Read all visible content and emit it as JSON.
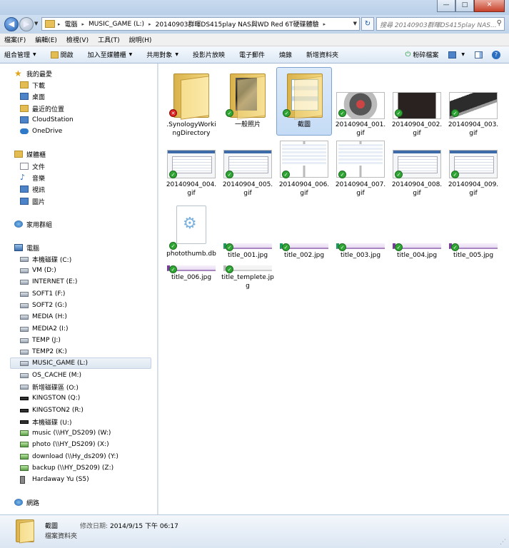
{
  "window": {
    "minimize_glyph": "—",
    "maximize_glyph": "□",
    "close_glyph": "✕"
  },
  "address": {
    "crumbs": [
      "電腦",
      "MUSIC_GAME (L:)",
      "20140903群暉DS415play NAS與WD Red 6T硬碟體驗"
    ],
    "search_placeholder": "搜尋 20140903群暉DS415play NAS..."
  },
  "menu": [
    "檔案(F)",
    "編輯(E)",
    "檢視(V)",
    "工具(T)",
    "說明(H)"
  ],
  "commands": {
    "organize": "組合管理",
    "open": "開啟",
    "include_library": "加入至媒體櫃",
    "share": "共用對象",
    "slideshow": "投影片放映",
    "email": "電子郵件",
    "burn": "燒錄",
    "new_folder": "新增資料夾",
    "shred": "粉碎檔案"
  },
  "nav": {
    "favorites": {
      "label": "我的最愛",
      "items": [
        "下載",
        "桌面",
        "最近的位置",
        "CloudStation",
        "OneDrive"
      ]
    },
    "libraries": {
      "label": "媒體櫃",
      "items": [
        "文件",
        "音樂",
        "視訊",
        "圖片"
      ]
    },
    "homegroup": "家用群組",
    "computer": {
      "label": "電腦",
      "items": [
        "本機磁碟 (C:)",
        "VM (D:)",
        "INTERNET (E:)",
        "SOFT1 (F:)",
        "SOFT2 (G:)",
        "MEDIA (H:)",
        "MEDIA2 (I:)",
        "TEMP (J:)",
        "TEMP2 (K:)",
        "MUSIC_GAME (L:)",
        "OS_CACHE (M:)",
        "新增磁碟區 (O:)",
        "KINGSTON (Q:)",
        "KINGSTON2 (R:)",
        "本機磁碟 (U:)",
        "music (\\\\HY_DS209) (W:)",
        "photo (\\\\HY_DS209) (X:)",
        "download (\\\\Hy_ds209) (Y:)",
        "backup (\\\\HY_DS209) (Z:)",
        "Hardaway Yu (S5)"
      ]
    },
    "network": "網路"
  },
  "files": [
    {
      "name": ".SynologyWorkingDirectory",
      "kind": "folder"
    },
    {
      "name": "一般照片",
      "kind": "folder-photo"
    },
    {
      "name": "截圖",
      "kind": "folder-screens"
    },
    {
      "name": "20140904_001.gif",
      "kind": "ph-hdd"
    },
    {
      "name": "20140904_002.gif",
      "kind": "ph-nas"
    },
    {
      "name": "20140904_003.gif",
      "kind": "ph-rail"
    },
    {
      "name": "20140904_004.gif",
      "kind": "ph-shot"
    },
    {
      "name": "20140904_005.gif",
      "kind": "ph-shot"
    },
    {
      "name": "20140904_006.gif",
      "kind": "ph-dual"
    },
    {
      "name": "20140904_007.gif",
      "kind": "ph-dual"
    },
    {
      "name": "20140904_008.gif",
      "kind": "ph-shot"
    },
    {
      "name": "20140904_009.gif",
      "kind": "ph-shot"
    },
    {
      "name": "photothumb.db",
      "kind": "doc"
    },
    {
      "name": "title_001.jpg",
      "kind": "banner"
    },
    {
      "name": "title_002.jpg",
      "kind": "banner"
    },
    {
      "name": "title_003.jpg",
      "kind": "banner"
    },
    {
      "name": "title_004.jpg",
      "kind": "banner"
    },
    {
      "name": "title_005.jpg",
      "kind": "banner"
    },
    {
      "name": "title_006.jpg",
      "kind": "banner"
    },
    {
      "name": "title_templete.jpg",
      "kind": "banner"
    }
  ],
  "details": {
    "name": "截圖",
    "type": "檔案資料夾",
    "modified_label": "修改日期:",
    "modified_value": "2014/9/15 下午 06:17"
  }
}
